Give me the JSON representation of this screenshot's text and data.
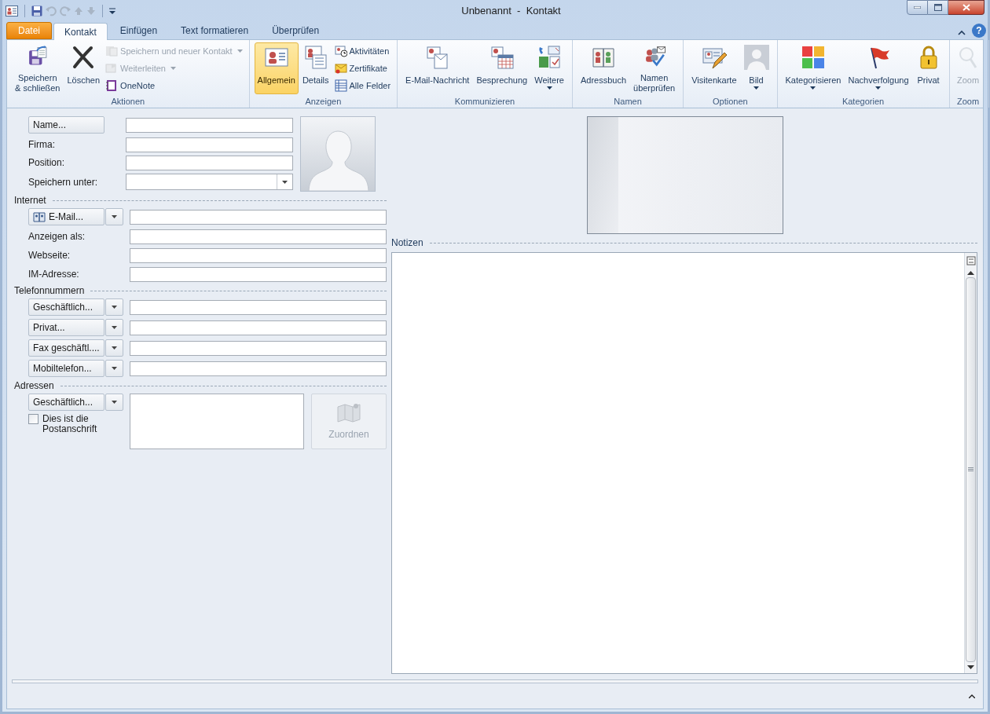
{
  "window": {
    "title": "Unbenannt  -  Kontakt"
  },
  "tabs": [
    {
      "label": "Datei",
      "kind": "file",
      "selected": false
    },
    {
      "label": "Kontakt",
      "kind": "tab",
      "selected": true
    },
    {
      "label": "Einfügen",
      "kind": "tab",
      "selected": false
    },
    {
      "label": "Text formatieren",
      "kind": "tab",
      "selected": false
    },
    {
      "label": "Überprüfen",
      "kind": "tab",
      "selected": false
    }
  ],
  "help_button": {
    "label": "?"
  },
  "ribbon": {
    "groups": [
      {
        "label": "Aktionen",
        "items": [
          {
            "label": "Speichern\n& schließen",
            "kind": "large",
            "disabled": false,
            "dropdown": false,
            "selected": false
          },
          {
            "label": "Löschen",
            "kind": "large",
            "disabled": false,
            "dropdown": false,
            "selected": false
          },
          {
            "label": "Speichern und neuer Kontakt",
            "kind": "small",
            "disabled": true,
            "dropdown": true
          },
          {
            "label": "Weiterleiten",
            "kind": "small",
            "disabled": true,
            "dropdown": true
          },
          {
            "label": "OneNote",
            "kind": "small",
            "disabled": false,
            "dropdown": false
          }
        ]
      },
      {
        "label": "Anzeigen",
        "items": [
          {
            "label": "Allgemein",
            "kind": "large",
            "disabled": false,
            "dropdown": false,
            "selected": true
          },
          {
            "label": "Details",
            "kind": "large",
            "disabled": false,
            "dropdown": false,
            "selected": false
          },
          {
            "label": "Aktivitäten",
            "kind": "small",
            "disabled": false,
            "dropdown": false
          },
          {
            "label": "Zertifikate",
            "kind": "small",
            "disabled": false,
            "dropdown": false
          },
          {
            "label": "Alle Felder",
            "kind": "small",
            "disabled": false,
            "dropdown": false
          }
        ]
      },
      {
        "label": "Kommunizieren",
        "items": [
          {
            "label": "E-Mail-Nachricht",
            "kind": "large",
            "disabled": false,
            "dropdown": false,
            "selected": false
          },
          {
            "label": "Besprechung",
            "kind": "large",
            "disabled": false,
            "dropdown": false,
            "selected": false
          },
          {
            "label": "Weitere",
            "kind": "large",
            "disabled": false,
            "dropdown": true,
            "selected": false
          }
        ]
      },
      {
        "label": "Namen",
        "items": [
          {
            "label": "Adressbuch",
            "kind": "large",
            "disabled": false,
            "dropdown": false,
            "selected": false
          },
          {
            "label": "Namen\nüberprüfen",
            "kind": "large",
            "disabled": false,
            "dropdown": false,
            "selected": false
          }
        ]
      },
      {
        "label": "Optionen",
        "items": [
          {
            "label": "Visitenkarte",
            "kind": "large",
            "disabled": false,
            "dropdown": false,
            "selected": false
          },
          {
            "label": "Bild",
            "kind": "large",
            "disabled": false,
            "dropdown": true,
            "selected": false
          }
        ]
      },
      {
        "label": "Kategorien",
        "items": [
          {
            "label": "Kategorisieren",
            "kind": "large",
            "disabled": false,
            "dropdown": true,
            "selected": false
          },
          {
            "label": "Nachverfolgung",
            "kind": "large",
            "disabled": false,
            "dropdown": true,
            "selected": false
          },
          {
            "label": "Privat",
            "kind": "large",
            "disabled": false,
            "dropdown": false,
            "selected": false
          }
        ]
      },
      {
        "label": "Zoom",
        "items": [
          {
            "label": "Zoom",
            "kind": "large",
            "disabled": true,
            "dropdown": false,
            "selected": false
          }
        ]
      }
    ]
  },
  "general": [
    {
      "kind": "button",
      "label": "Name..."
    },
    {
      "kind": "label",
      "label": "Firma:"
    },
    {
      "kind": "label",
      "label": "Position:"
    },
    {
      "kind": "combo",
      "label": "Speichern unter:"
    }
  ],
  "sections": [
    {
      "title": "Internet",
      "rows": [
        {
          "kind": "split",
          "label": "E-Mail...",
          "book_icon": true
        },
        {
          "kind": "label",
          "label": "Anzeigen als:"
        },
        {
          "kind": "label",
          "label": "Webseite:"
        },
        {
          "kind": "label",
          "label": "IM-Adresse:"
        }
      ]
    },
    {
      "title": "Telefonnummern",
      "rows": [
        {
          "kind": "split",
          "label": "Geschäftlich..."
        },
        {
          "kind": "split",
          "label": "Privat..."
        },
        {
          "kind": "split",
          "label": "Fax geschäftl...."
        },
        {
          "kind": "split",
          "label": "Mobiltelefon..."
        }
      ]
    },
    {
      "title": "Adressen",
      "rows": [
        {
          "kind": "address",
          "label": "Geschäftlich...",
          "checkbox": {
            "label": "Dies ist die\nPostanschrift",
            "checked": false
          },
          "map_button": {
            "label": "Zuordnen",
            "disabled": true
          }
        }
      ]
    }
  ],
  "notes": {
    "label": "Notizen"
  }
}
